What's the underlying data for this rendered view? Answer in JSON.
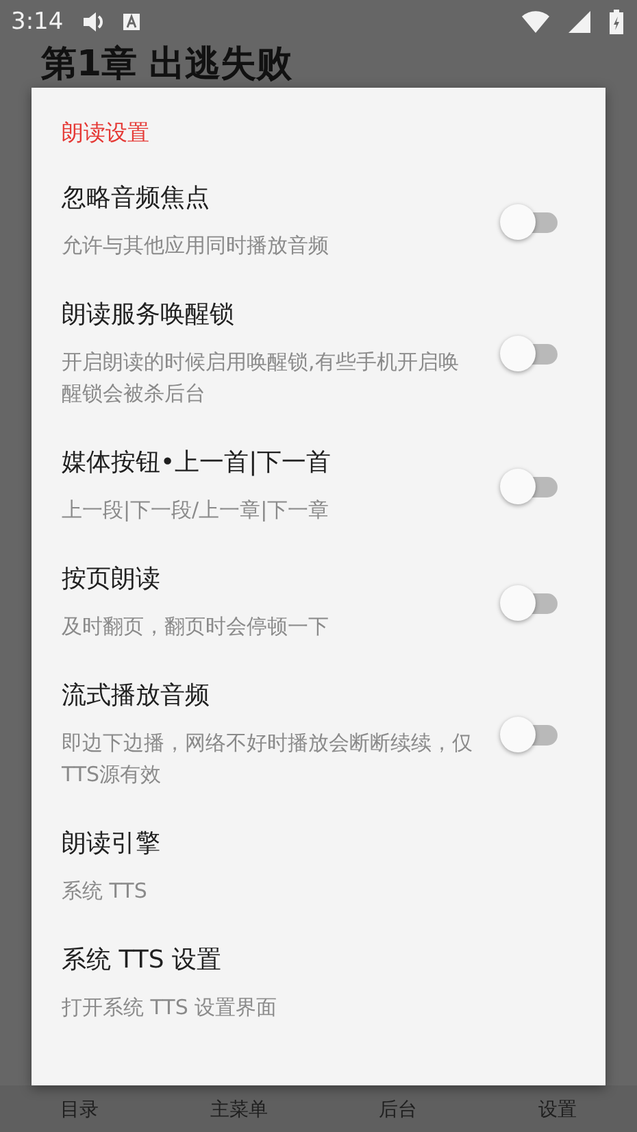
{
  "status_bar": {
    "time": "3:14"
  },
  "reader": {
    "chapter_title": "第1章 出逃失败"
  },
  "bottom_nav": [
    {
      "label": "目录"
    },
    {
      "label": "主菜单"
    },
    {
      "label": "后台"
    },
    {
      "label": "设置"
    }
  ],
  "dialog": {
    "title": "朗读设置",
    "items": [
      {
        "kind": "switch",
        "title": "忽略音频焦点",
        "summary": "允许与其他应用同时播放音频",
        "on": false
      },
      {
        "kind": "switch",
        "title": "朗读服务唤醒锁",
        "summary": "开启朗读的时候启用唤醒锁,有些手机开启唤醒锁会被杀后台",
        "on": false
      },
      {
        "kind": "switch",
        "title": "媒体按钮•上一首|下一首",
        "summary": "上一段|下一段/上一章|下一章",
        "on": false
      },
      {
        "kind": "switch",
        "title": "按页朗读",
        "summary": "及时翻页，翻页时会停顿一下",
        "on": false
      },
      {
        "kind": "switch",
        "title": "流式播放音频",
        "summary": "即边下边播，网络不好时播放会断断续续，仅TTS源有效",
        "on": false
      },
      {
        "kind": "option",
        "title": "朗读引擎",
        "summary": "系统 TTS"
      },
      {
        "kind": "option",
        "title": "系统 TTS 设置",
        "summary": "打开系统 TTS 设置界面"
      }
    ]
  }
}
